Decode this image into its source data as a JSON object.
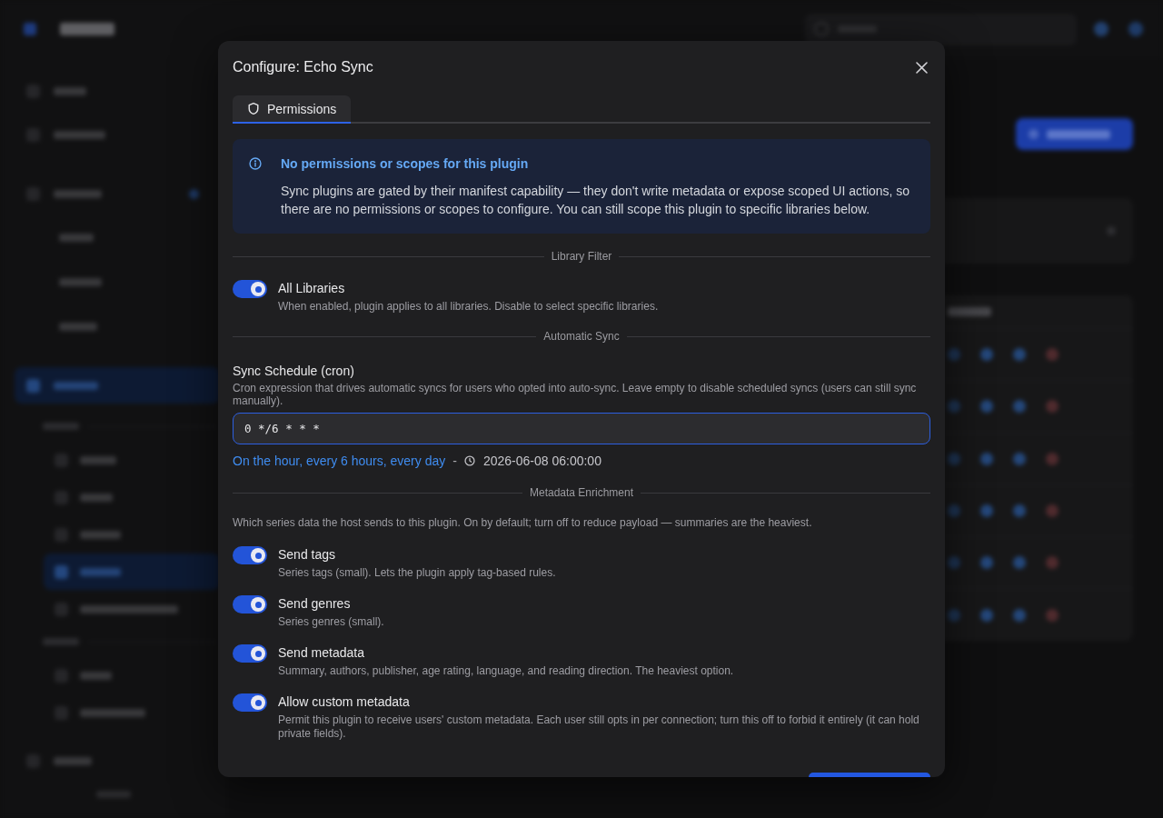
{
  "modal": {
    "title": "Configure: Echo Sync",
    "tabs": [
      {
        "label": "Permissions",
        "selected": true
      }
    ],
    "notice": {
      "title": "No permissions or scopes for this plugin",
      "text": "Sync plugins are gated by their manifest capability — they don't write metadata or expose scoped UI actions, so there are no permissions or scopes to configure. You can still scope this plugin to specific libraries below."
    },
    "sections": [
      {
        "heading": "Library Filter",
        "items": [
          {
            "kind": "switch",
            "label": "All Libraries",
            "description": "When enabled, plugin applies to all libraries. Disable to select specific libraries.",
            "on": true
          }
        ]
      },
      {
        "heading": "Automatic Sync",
        "items": [
          {
            "kind": "cron",
            "label": "Sync Schedule (cron)",
            "description": "Cron expression that drives automatic syncs for users who opted into auto-sync. Leave empty to disable scheduled syncs (users can still sync manually).",
            "value": "0 */6 * * *",
            "focused": true,
            "summary": "On the hour, every 6 hours, every day",
            "separator": "-",
            "next_run": "2026-06-08 06:00:00"
          }
        ]
      },
      {
        "heading": "Metadata Enrichment",
        "items": [
          {
            "kind": "text",
            "text": "Which series data the host sends to this plugin. On by default; turn off to reduce payload — summaries are the heaviest."
          },
          {
            "kind": "switch",
            "label": "Send tags",
            "description": "Series tags (small). Lets the plugin apply tag-based rules.",
            "on": true
          },
          {
            "kind": "switch",
            "label": "Send genres",
            "description": "Series genres (small).",
            "on": true
          },
          {
            "kind": "switch",
            "label": "Send metadata",
            "description": "Summary, authors, publisher, age rating, language, and reading direction. The heaviest option.",
            "on": true
          },
          {
            "kind": "switch",
            "label": "Allow custom metadata",
            "description": "Permit this plugin to receive users' custom metadata. Each user still opts in per connection; turn this off to forbid it entirely (it can hold private fields).",
            "on": true
          }
        ]
      }
    ]
  }
}
